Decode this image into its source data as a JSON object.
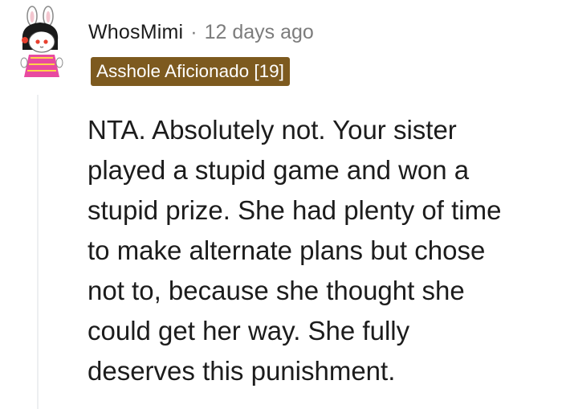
{
  "comment": {
    "author": "WhosMimi",
    "separator": "·",
    "timestamp": "12 days ago",
    "flair": "Asshole Aficionado [19]",
    "avatar_icon": "snoo-bunny-avatar-icon",
    "flair_color": "#7d5a1f",
    "body_lines": [
      "NTA. Absolutely not. Your sister",
      "played a stupid game and won a",
      "stupid prize. She had plenty of time",
      "to make alternate plans but chose",
      "not to, because she thought she",
      "could get her way. She fully",
      "deserves this punishment."
    ]
  }
}
